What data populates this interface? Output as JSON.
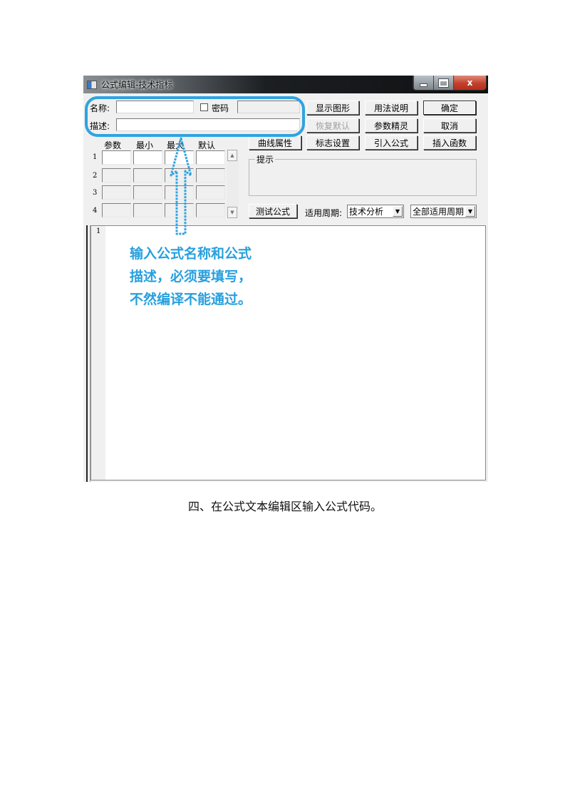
{
  "window": {
    "title": "公式编辑-技术指标",
    "caption_buttons": {
      "minimize": "minimize",
      "maximize": "maximize",
      "close": "x"
    }
  },
  "form": {
    "name_label": "名称:",
    "name_value": "",
    "password_checkbox_label": "密码",
    "password_checked": false,
    "password_value": "",
    "desc_label": "描述:",
    "desc_value": ""
  },
  "buttons": {
    "show_graph": "显示图形",
    "usage": "用法说明",
    "ok": "确定",
    "restore_default": "恢复默认",
    "param_wizard": "参数精灵",
    "cancel": "取消",
    "curve_props": "曲线属性",
    "marker_settings": "标志设置",
    "import_formula": "引入公式",
    "insert_function": "插入函数",
    "test_formula": "测试公式"
  },
  "params": {
    "headers": [
      "参数",
      "最小",
      "最大",
      "默认"
    ],
    "rows": [
      {
        "num": "1",
        "values": [
          "",
          "",
          "",
          ""
        ]
      },
      {
        "num": "2",
        "values": [
          "",
          "",
          "",
          ""
        ]
      },
      {
        "num": "3",
        "values": [
          "",
          "",
          "",
          ""
        ]
      },
      {
        "num": "4",
        "values": [
          "",
          "",
          "",
          ""
        ]
      }
    ]
  },
  "hint": {
    "label": "提示",
    "text": ""
  },
  "period": {
    "label": "适用周期:",
    "type_selected": "技术分析",
    "scope_selected": "全部适用周期"
  },
  "editor": {
    "first_line_number": "1",
    "content": ""
  },
  "annotation": {
    "lines": [
      "输入公式名称和公式",
      "描述，必须要填写，",
      "不然编译不能通过。"
    ],
    "color": "#27a0de"
  },
  "caption": "四、在公式文本编辑区输入公式代码。"
}
